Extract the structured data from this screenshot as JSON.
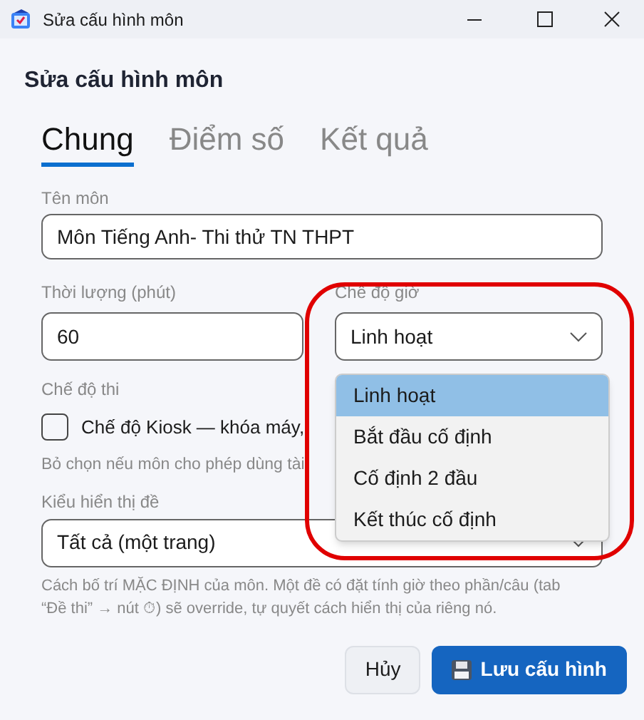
{
  "window": {
    "title": "Sửa cấu hình môn"
  },
  "heading": "Sửa cấu hình môn",
  "tabs": [
    {
      "label": "Chung",
      "selected": true
    },
    {
      "label": "Điểm số",
      "selected": false
    },
    {
      "label": "Kết quả",
      "selected": false
    }
  ],
  "name_field": {
    "label": "Tên môn",
    "value": "Môn Tiếng Anh- Thi thử TN THPT"
  },
  "duration_field": {
    "label": "Thời lượng (phút)",
    "value": "60"
  },
  "timing_mode": {
    "label": "Chế độ giờ",
    "value": "Linh hoạt",
    "expanded": true,
    "highlighted": true,
    "options": [
      {
        "label": "Linh hoạt",
        "selected": true
      },
      {
        "label": "Bắt đầu cố định",
        "selected": false
      },
      {
        "label": "Cố định 2 đầu",
        "selected": false
      },
      {
        "label": "Kết thúc cố định",
        "selected": false
      }
    ]
  },
  "exam_mode": {
    "label": "Chế độ thi",
    "kiosk": {
      "label": "Chế độ Kiosk — khóa máy,",
      "checked": false
    },
    "hint": "Bỏ chọn nếu môn cho phép dùng tài"
  },
  "display_mode": {
    "label": "Kiểu hiển thị đề",
    "value": "Tất cả (một trang)",
    "help": "Cách bố trí MẶC ĐỊNH của môn. Một đề có đặt tính giờ theo phần/câu (tab “Đề thi” → nút ⏱) sẽ override, tự quyết cách hiển thị của riêng nó."
  },
  "buttons": [
    {
      "label": "Hủy",
      "kind": "secondary"
    },
    {
      "label": "Lưu cấu hình",
      "kind": "primary"
    }
  ]
}
